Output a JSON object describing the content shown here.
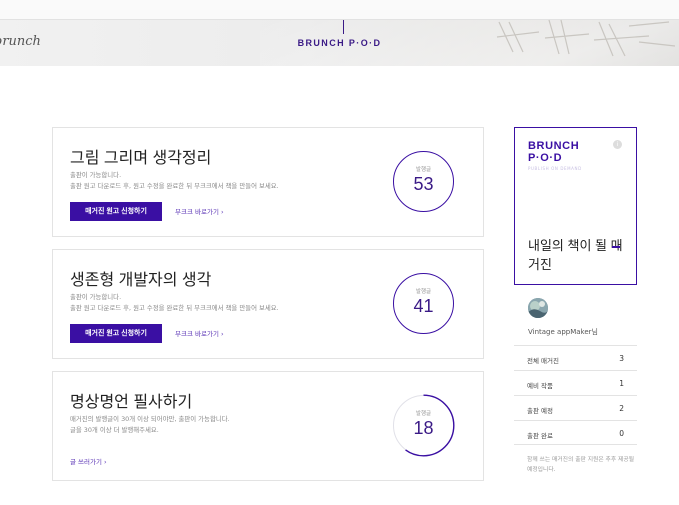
{
  "header": {
    "brand_script": "brunch",
    "pod_logo": "BRUNCH P·O·D"
  },
  "magazines": [
    {
      "title": "그림 그리며 생각정리",
      "desc_line1": "출판이 가능합니다.",
      "desc_line2": "출판 원고 다운로드 후, 원고 수정을 완료한 뒤 부크크에서 책을 만들어 보세요.",
      "apply_label": "매거진 원고 신청하기",
      "link_label": "부크크 바로가기 ›",
      "count_label": "발행글",
      "count": "53",
      "progress": 1.0
    },
    {
      "title": "생존형 개발자의 생각",
      "desc_line1": "출판이 가능합니다.",
      "desc_line2": "출판 원고 다운로드 후, 원고 수정을 완료한 뒤 부크크에서 책을 만들어 보세요.",
      "apply_label": "매거진 원고 신청하기",
      "link_label": "부크크 바로가기 ›",
      "count_label": "발행글",
      "count": "41",
      "progress": 1.0
    },
    {
      "title": "명상명언 필사하기",
      "desc_line1": "매거진의 발행글이 30개 이상 되어야만, 출판이 가능합니다.",
      "desc_line2": "글을 30개 이상 더 발행해주세요.",
      "link_label": "글 쓰러가기 ›",
      "count_label": "발행글",
      "count": "18",
      "progress": 0.6
    }
  ],
  "pod_card": {
    "pod_word_1": "BRUNCH",
    "pod_word_2": "P·O·D",
    "pod_sub": "PUBLISH ON DEMAND",
    "info_icon": "i",
    "tagline": "내일의 책이 될 매거진"
  },
  "user": {
    "name": "Vintage appMaker님"
  },
  "stats": [
    {
      "label": "전체 매거진",
      "value": "3"
    },
    {
      "label": "예비 작품",
      "value": "1"
    },
    {
      "label": "출판 예정",
      "value": "2"
    },
    {
      "label": "출판 완료",
      "value": "0"
    }
  ],
  "note": "함께 쓰는 매거진의 출판 지원은 추후 제공될 예정입니다.",
  "colors": {
    "accent": "#3a0fa3",
    "logo": "#3a1a86",
    "link": "#5b35b6"
  }
}
